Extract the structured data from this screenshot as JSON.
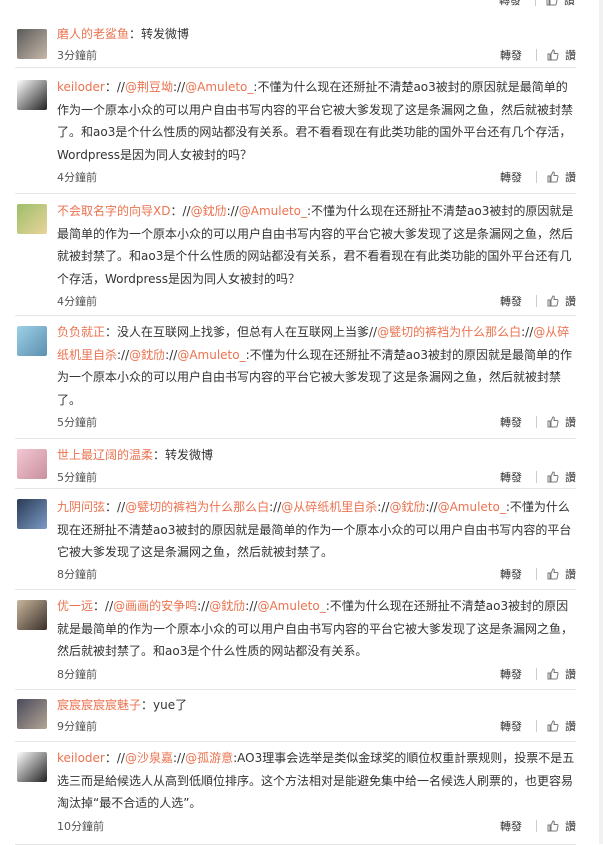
{
  "ui": {
    "repost_label": "轉發",
    "like_label": "讚"
  },
  "comments": [
    {
      "name": "磨人的老鲨鱼",
      "segments": [
        {
          "type": "text",
          "text": "：转发微博"
        }
      ],
      "time": "3分鐘前"
    },
    {
      "name": "keiloder",
      "segments": [
        {
          "type": "text",
          "text": "："
        },
        {
          "type": "text",
          "text": "//"
        },
        {
          "type": "mention",
          "text": "@荆豆坳"
        },
        {
          "type": "text",
          "text": "://"
        },
        {
          "type": "mention",
          "text": "@Amuleto_"
        },
        {
          "type": "text",
          "text": ":不懂为什么现在还掰扯不清楚ao3被封的原因就是最简单的作为一个原本小众的可以用户自由书写内容的平台它被大爹发现了这是条漏网之鱼，然后就被封禁了。和ao3是个什么性质的网站都没有关系。君不看看现在有此类功能的国外平台还有几个存活，Wordpress是因为同人女被封的吗？"
        }
      ],
      "time": "4分鐘前"
    },
    {
      "name": "不会取名字的向导XD",
      "segments": [
        {
          "type": "text",
          "text": "："
        },
        {
          "type": "text",
          "text": "//"
        },
        {
          "type": "mention",
          "text": "@鈂劤"
        },
        {
          "type": "text",
          "text": "://"
        },
        {
          "type": "mention",
          "text": "@Amuleto_"
        },
        {
          "type": "text",
          "text": ":不懂为什么现在还掰扯不清楚ao3被封的原因就是最简单的作为一个原本小众的可以用户自由书写内容的平台它被大爹发现了这是条漏网之鱼，然后就被封禁了。和ao3是个什么性质的网站都没有关系，君不看看现在有此类功能的国外平台还有几个存活，Wordpress是因为同人女被封的吗？"
        }
      ],
      "time": "4分鐘前"
    },
    {
      "name": "负负就正",
      "segments": [
        {
          "type": "text",
          "text": "：没人在互联网上找爹，但总有人在互联网上当爹//"
        },
        {
          "type": "mention",
          "text": "@甓切的裤裆为什么那么白"
        },
        {
          "type": "text",
          "text": "://"
        },
        {
          "type": "mention",
          "text": "@从碎纸机里自杀"
        },
        {
          "type": "text",
          "text": "://"
        },
        {
          "type": "mention",
          "text": "@鈂劤"
        },
        {
          "type": "text",
          "text": "://"
        },
        {
          "type": "mention",
          "text": "@Amuleto_"
        },
        {
          "type": "text",
          "text": ":不懂为什么现在还掰扯不清楚ao3被封的原因就是最简单的作为一个原本小众的可以用户自由书写内容的平台它被大爹发现了这是条漏网之鱼，然后就被封禁了。"
        }
      ],
      "time": "5分鐘前"
    },
    {
      "name": "世上最辽阔的温柔",
      "segments": [
        {
          "type": "text",
          "text": "：转发微博"
        }
      ],
      "time": "5分鐘前"
    },
    {
      "name": "九阴问弦",
      "segments": [
        {
          "type": "text",
          "text": "："
        },
        {
          "type": "text",
          "text": "//"
        },
        {
          "type": "mention",
          "text": "@甓切的裤裆为什么那么白"
        },
        {
          "type": "text",
          "text": "://"
        },
        {
          "type": "mention",
          "text": "@从碎纸机里自杀"
        },
        {
          "type": "text",
          "text": "://"
        },
        {
          "type": "mention",
          "text": "@鈂劤"
        },
        {
          "type": "text",
          "text": "://"
        },
        {
          "type": "mention",
          "text": "@Amuleto_"
        },
        {
          "type": "text",
          "text": ":不懂为什么现在还掰扯不清楚ao3被封的原因就是最简单的作为一个原本小众的可以用户自由书写内容的平台它被大爹发现了这是条漏网之鱼，然后就被封禁了。"
        }
      ],
      "time": "8分鐘前"
    },
    {
      "name": "优一远",
      "segments": [
        {
          "type": "text",
          "text": "："
        },
        {
          "type": "text",
          "text": "//"
        },
        {
          "type": "mention",
          "text": "@画画的安争鸣"
        },
        {
          "type": "text",
          "text": "://"
        },
        {
          "type": "mention",
          "text": "@鈂劤"
        },
        {
          "type": "text",
          "text": "://"
        },
        {
          "type": "mention",
          "text": "@Amuleto_"
        },
        {
          "type": "text",
          "text": ":不懂为什么现在还掰扯不清楚ao3被封的原因就是最简单的作为一个原本小众的可以用户自由书写内容的平台它被大爹发现了这是条漏网之鱼，然后就被封禁了。和ao3是个什么性质的网站都没有关系。"
        }
      ],
      "time": "8分鐘前"
    },
    {
      "name": "宸宸宸宸宸魅子",
      "segments": [
        {
          "type": "text",
          "text": "：yue了"
        }
      ],
      "time": "9分鐘前"
    },
    {
      "name": "keiloder",
      "segments": [
        {
          "type": "text",
          "text": "："
        },
        {
          "type": "text",
          "text": "//"
        },
        {
          "type": "mention",
          "text": "@沙泉嘉"
        },
        {
          "type": "text",
          "text": "://"
        },
        {
          "type": "mention",
          "text": "@孤游意"
        },
        {
          "type": "text",
          "text": ":AO3理事会选举是类似金球奖的順位权重計票规则，投票不是五选三而是給候选人从高到低順位排序。这个方法相对是能避免集中给一名候选人刷票的，也更容易淘汰掉“最不合适的人选”。"
        }
      ],
      "time": "10分鐘前"
    }
  ]
}
